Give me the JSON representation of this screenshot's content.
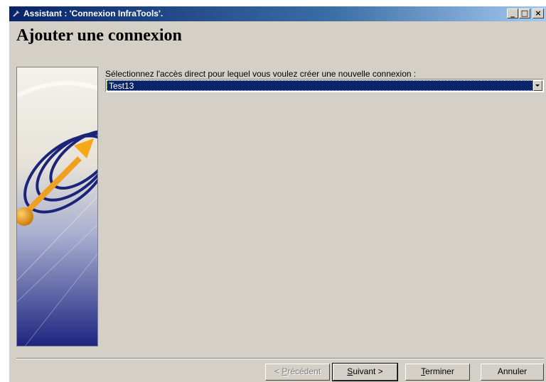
{
  "window": {
    "title": "Assistant : 'Connexion InfraTools'.",
    "controls": {
      "minimize": "_",
      "maximize": "□",
      "close": "×"
    }
  },
  "wizard": {
    "heading": "Ajouter une connexion",
    "prompt": "Sélectionnez l'accès direct pour lequel vous voulez créer une nouvelle connexion :",
    "selected_access": "Test13"
  },
  "buttons": {
    "previous": {
      "prefix": "< ",
      "mnemonic": "P",
      "rest": "récédent"
    },
    "next": {
      "mnemonic": "S",
      "rest": "uivant >"
    },
    "finish": {
      "mnemonic": "T",
      "rest": "erminer"
    },
    "cancel": {
      "label": "Annuler"
    }
  },
  "colors": {
    "titlebar": "#0a246a",
    "selection": "#0a246a",
    "face": "#d4d0c8"
  }
}
